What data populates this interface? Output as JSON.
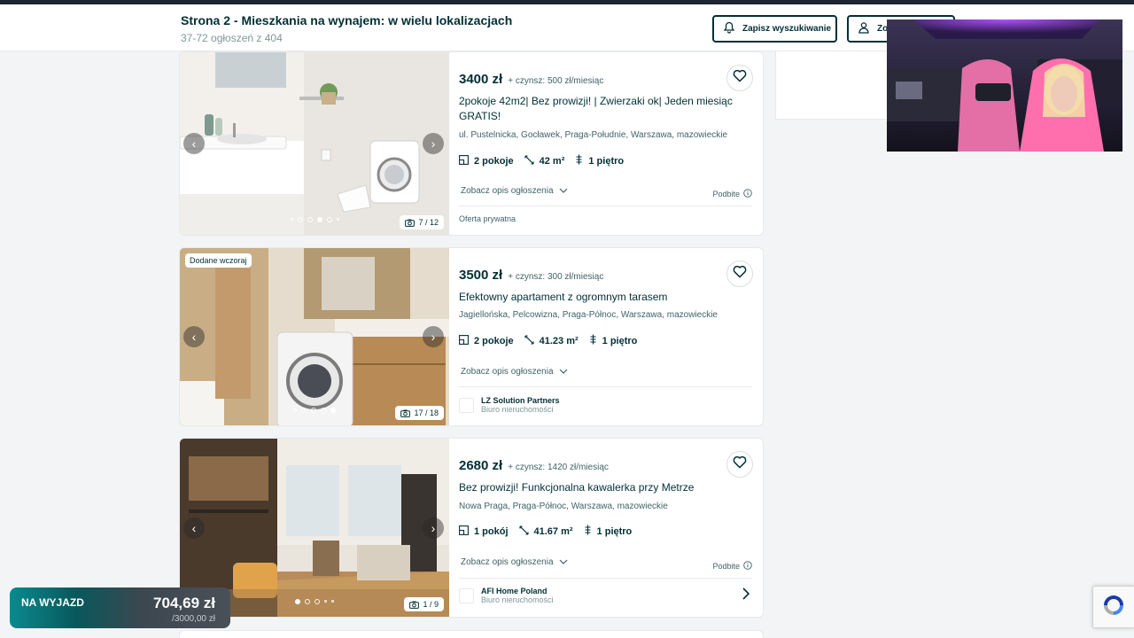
{
  "header": {
    "title": "Strona 2 - Mieszkania na wynajem: w wielu lokalizacjach",
    "subtitle": "37-72 ogłoszeń z 404",
    "save_search_label": "Zapisz wyszukiwanie",
    "observed_label": "Zo"
  },
  "listings": [
    {
      "price": "3400 zł",
      "rent": "+ czynsz: 500 zł/miesiąc",
      "title": "2pokoje 42m2| Bez prowizji! | Zwierzaki ok| Jeden miesiąc GRATIS!",
      "location": "ul. Pustelnicka, Gocławek, Praga-Południe, Warszawa, mazowieckie",
      "rooms": "2 pokoje",
      "area": "42 m²",
      "floor": "1 piętro",
      "more_label": "Zobacz opis ogłoszenia",
      "boosted_label": "Podbite",
      "photo_counter": "7 / 12",
      "photo_progress": 0.58,
      "badge": "",
      "seller_private": "Oferta prywatna"
    },
    {
      "price": "3500 zł",
      "rent": "+ czynsz: 300 zł/miesiąc",
      "title": "Efektowny apartament z ogromnym tarasem",
      "location": "Jagiellońska, Pelcowizna, Praga-Północ, Warszawa, mazowieckie",
      "rooms": "2 pokoje",
      "area": "41.23 m²",
      "floor": "1 piętro",
      "more_label": "Zobacz opis ogłoszenia",
      "photo_counter": "17 / 18",
      "photo_progress": 0.94,
      "badge": "Dodane wczoraj",
      "agent_name": "LZ Solution Partners",
      "agent_type": "Biuro nieruchomości"
    },
    {
      "price": "2680 zł",
      "rent": "+ czynsz: 1420 zł/miesiąc",
      "title": "Bez prowizji! Funkcjonalna kawalerka przy Metrze",
      "location": "Nowa Praga, Praga-Północ, Warszawa, mazowieckie",
      "rooms": "1 pokój",
      "area": "41.67 m²",
      "floor": "1 piętro",
      "more_label": "Zobacz opis ogłoszenia",
      "boosted_label": "Podbite",
      "photo_counter": "1 / 9",
      "photo_progress": 0.11,
      "badge": "",
      "agent_name": "AFI Home Poland",
      "agent_type": "Biuro nieruchomości"
    }
  ],
  "overlay": {
    "label": "NA WYJAZD",
    "amount": "704,69 zł",
    "sub": "/3000,00 zł",
    "progress": 0.23
  },
  "icons": {
    "bell": "bell-icon",
    "heart": "heart-icon",
    "camera": "camera-icon",
    "rooms": "floorplan-icon",
    "area": "ruler-icon",
    "floor": "stairs-icon",
    "info": "info-icon",
    "chevron": "chevron-down-icon"
  },
  "colors": {
    "brand_dark": "#002f34",
    "muted": "#406367",
    "page_bg": "#f2f4f5",
    "overlay_teal": "#0b8a8f"
  }
}
